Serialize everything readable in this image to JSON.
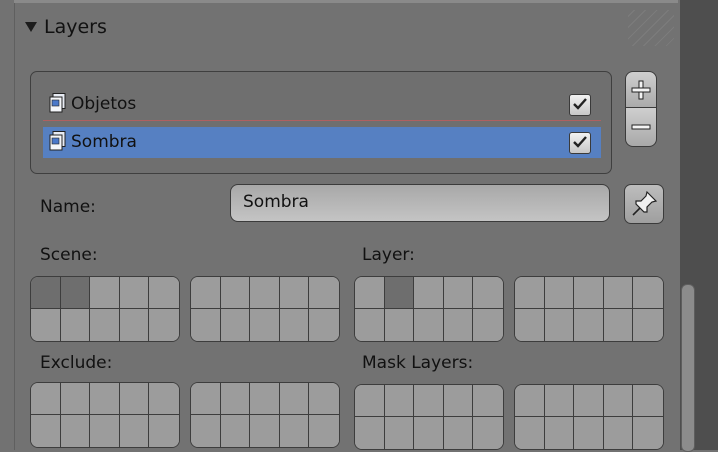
{
  "panel": {
    "title": "Layers",
    "layers": [
      {
        "name": "Objetos",
        "checked": true,
        "selected": false
      },
      {
        "name": "Sombra",
        "checked": true,
        "selected": true
      }
    ],
    "add_symbol": "+",
    "remove_symbol": "−",
    "name_label": "Name:",
    "name_value": "Sombra",
    "scene_label": "Scene:",
    "layer_label": "Layer:",
    "exclude_label": "Exclude:",
    "mask_label": "Mask Layers:",
    "grids": {
      "scene_left": [
        0,
        1
      ],
      "scene_right": [],
      "layer_left": [
        1
      ],
      "layer_right": [],
      "exclude_left": [],
      "exclude_right": [],
      "mask_left": [],
      "mask_right": []
    }
  },
  "colors": {
    "panel_bg": "#727272",
    "selection": "#5680c2",
    "active_cell": "#6e6e6e"
  }
}
